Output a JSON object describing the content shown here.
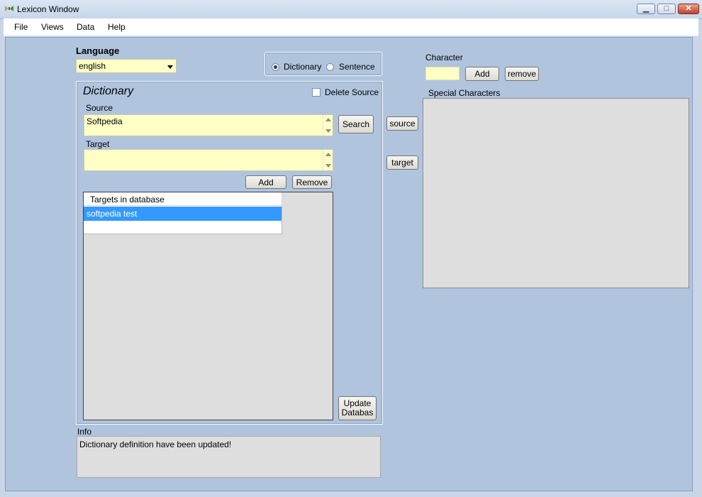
{
  "window": {
    "title": "Lexicon Window",
    "min_glyph": "▁",
    "max_glyph": "□",
    "close_glyph": "✕"
  },
  "menubar": [
    {
      "label": "File"
    },
    {
      "label": "Views"
    },
    {
      "label": "Data"
    },
    {
      "label": "Help"
    }
  ],
  "language": {
    "label": "Language",
    "selected": "english"
  },
  "mode": {
    "options": [
      "Dictionary",
      "Sentence"
    ],
    "selected": "Dictionary"
  },
  "dictionary": {
    "title": "Dictionary",
    "delete_source_label": "Delete Source",
    "delete_source_checked": false,
    "source_label": "Source",
    "source_value": "Softpedia",
    "target_label": "Target",
    "target_value": "",
    "search_label": "Search",
    "add_label": "Add",
    "remove_label": "Remove",
    "targets_header": "Targets in database",
    "targets": [
      {
        "text": "softpedia test",
        "selected": true
      }
    ],
    "update_label_line1": "Update",
    "update_label_line2": "Databas"
  },
  "middle": {
    "source_label": "source",
    "target_label": "target"
  },
  "character": {
    "label": "Character",
    "value": "",
    "add_label": "Add",
    "remove_label": "remove",
    "special_label": "Special Characters"
  },
  "info": {
    "label": "Info",
    "text": "Dictionary definition have been updated!"
  },
  "colors": {
    "field_bg": "#ffffc6",
    "selection": "#3399ff",
    "client_bg": "#b0c4de"
  }
}
